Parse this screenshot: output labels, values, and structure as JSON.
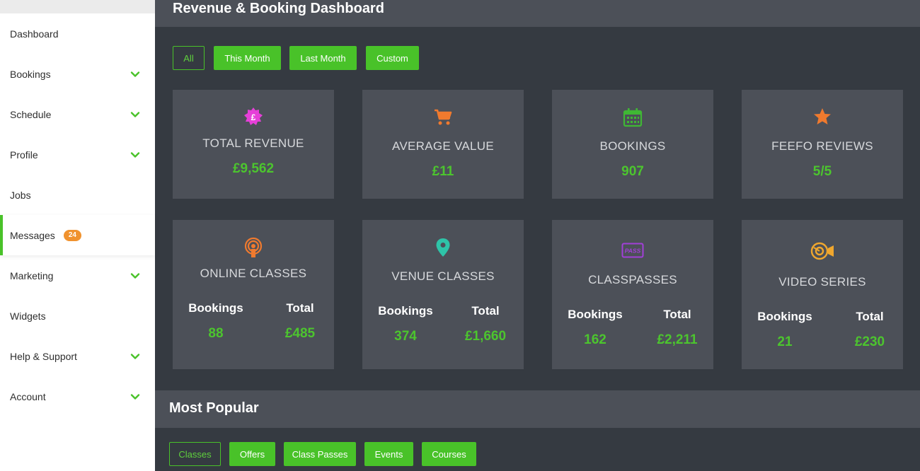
{
  "sidebar": {
    "items": [
      {
        "label": "Dashboard",
        "chevron": false
      },
      {
        "label": "Bookings",
        "chevron": true
      },
      {
        "label": "Schedule",
        "chevron": true
      },
      {
        "label": "Profile",
        "chevron": true
      },
      {
        "label": "Jobs",
        "chevron": false
      },
      {
        "label": "Messages",
        "chevron": false,
        "badge": "24"
      },
      {
        "label": "Marketing",
        "chevron": true
      },
      {
        "label": "Widgets",
        "chevron": false
      },
      {
        "label": "Help & Support",
        "chevron": true
      },
      {
        "label": "Account",
        "chevron": true
      }
    ]
  },
  "dashboard": {
    "title": "Revenue & Booking Dashboard",
    "filters": [
      "All",
      "This Month",
      "Last Month",
      "Custom"
    ],
    "stats": [
      {
        "icon": "pound-badge-icon",
        "label": "TOTAL REVENUE",
        "value": "£9,562"
      },
      {
        "icon": "shopping-cart-icon",
        "label": "AVERAGE VALUE",
        "value": "£11"
      },
      {
        "icon": "calendar-icon",
        "label": "BOOKINGS",
        "value": "907"
      },
      {
        "icon": "star-icon",
        "label": "FEEFO REVIEWS",
        "value": "5/5"
      }
    ],
    "categories": [
      {
        "icon": "broadcast-icon",
        "label": "ONLINE CLASSES",
        "bookings_label": "Bookings",
        "total_label": "Total",
        "bookings": "88",
        "total": "£485"
      },
      {
        "icon": "map-pin-icon",
        "label": "VENUE CLASSES",
        "bookings_label": "Bookings",
        "total_label": "Total",
        "bookings": "374",
        "total": "£1,660"
      },
      {
        "icon": "pass-ticket-icon",
        "icon_text": "PASS",
        "label": "CLASSPASSES",
        "bookings_label": "Bookings",
        "total_label": "Total",
        "bookings": "162",
        "total": "£2,211"
      },
      {
        "icon": "video-camera-icon",
        "label": "VIDEO SERIES",
        "bookings_label": "Bookings",
        "total_label": "Total",
        "bookings": "21",
        "total": "£230"
      }
    ]
  },
  "popular": {
    "title": "Most Popular",
    "tabs": [
      "Classes",
      "Offers",
      "Class Passes",
      "Events",
      "Courses"
    ]
  },
  "colors": {
    "accent": "#49c229",
    "sidebar_bg": "#ffffff",
    "panel_bg": "#4c5058",
    "page_bg": "#353a41",
    "badge": "#f0922e",
    "icon_pink": "#e63fd8",
    "icon_orange": "#f07a2e",
    "icon_green": "#3fb834",
    "icon_teal": "#2ec4a8",
    "icon_purple": "#a23fd8",
    "icon_yellow": "#f0a72e"
  }
}
